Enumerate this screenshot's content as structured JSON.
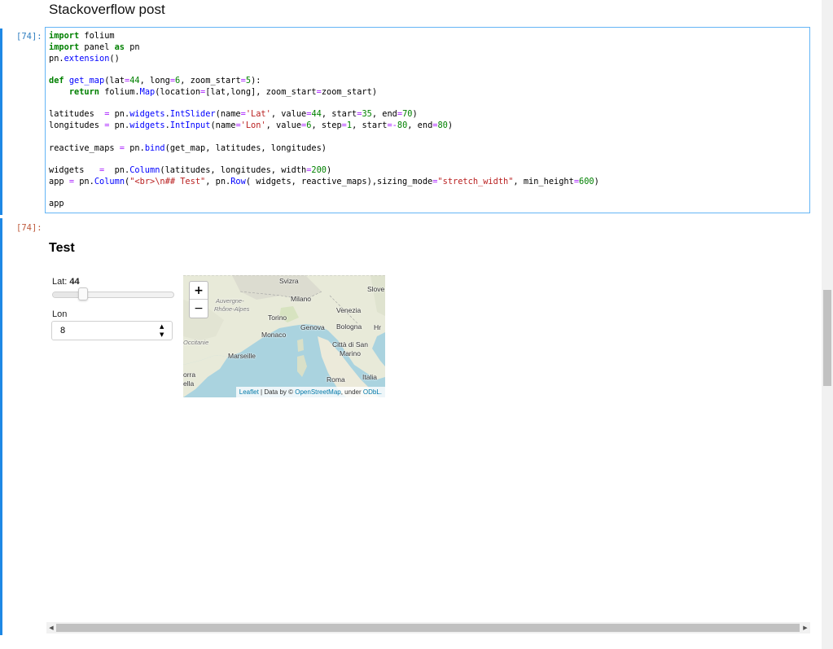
{
  "heading": "Stackoverflow post",
  "cell": {
    "in_prompt": "[74]:",
    "out_prompt": "[74]:",
    "code_lines": [
      [
        {
          "t": "import",
          "c": "kw"
        },
        {
          "t": " folium",
          "c": ""
        }
      ],
      [
        {
          "t": "import",
          "c": "kw"
        },
        {
          "t": " panel ",
          "c": ""
        },
        {
          "t": "as",
          "c": "kw"
        },
        {
          "t": " pn",
          "c": ""
        }
      ],
      [
        {
          "t": "pn",
          "c": ""
        },
        {
          "t": ".",
          "c": ""
        },
        {
          "t": "extension",
          "c": "fn"
        },
        {
          "t": "()",
          "c": ""
        }
      ],
      [],
      [
        {
          "t": "def",
          "c": "kw"
        },
        {
          "t": " ",
          "c": ""
        },
        {
          "t": "get_map",
          "c": "fn"
        },
        {
          "t": "(lat",
          "c": ""
        },
        {
          "t": "=",
          "c": "op"
        },
        {
          "t": "44",
          "c": "nu"
        },
        {
          "t": ", long",
          "c": ""
        },
        {
          "t": "=",
          "c": "op"
        },
        {
          "t": "6",
          "c": "nu"
        },
        {
          "t": ", zoom_start",
          "c": ""
        },
        {
          "t": "=",
          "c": "op"
        },
        {
          "t": "5",
          "c": "nu"
        },
        {
          "t": "):",
          "c": ""
        }
      ],
      [
        {
          "t": "    ",
          "c": ""
        },
        {
          "t": "return",
          "c": "kw"
        },
        {
          "t": " folium.",
          "c": ""
        },
        {
          "t": "Map",
          "c": "fn"
        },
        {
          "t": "(location",
          "c": ""
        },
        {
          "t": "=",
          "c": "op"
        },
        {
          "t": "[lat,long], zoom_start",
          "c": ""
        },
        {
          "t": "=",
          "c": "op"
        },
        {
          "t": "zoom_start)",
          "c": ""
        }
      ],
      [],
      [
        {
          "t": "latitudes  ",
          "c": ""
        },
        {
          "t": "=",
          "c": "op"
        },
        {
          "t": " pn.",
          "c": ""
        },
        {
          "t": "widgets",
          "c": "fn"
        },
        {
          "t": ".",
          "c": ""
        },
        {
          "t": "IntSlider",
          "c": "fn"
        },
        {
          "t": "(name",
          "c": ""
        },
        {
          "t": "=",
          "c": "op"
        },
        {
          "t": "'Lat'",
          "c": "st"
        },
        {
          "t": ", value",
          "c": ""
        },
        {
          "t": "=",
          "c": "op"
        },
        {
          "t": "44",
          "c": "nu"
        },
        {
          "t": ", start",
          "c": ""
        },
        {
          "t": "=",
          "c": "op"
        },
        {
          "t": "35",
          "c": "nu"
        },
        {
          "t": ", end",
          "c": ""
        },
        {
          "t": "=",
          "c": "op"
        },
        {
          "t": "70",
          "c": "nu"
        },
        {
          "t": ")",
          "c": ""
        }
      ],
      [
        {
          "t": "longitudes ",
          "c": ""
        },
        {
          "t": "=",
          "c": "op"
        },
        {
          "t": " pn.",
          "c": ""
        },
        {
          "t": "widgets",
          "c": "fn"
        },
        {
          "t": ".",
          "c": ""
        },
        {
          "t": "IntInput",
          "c": "fn"
        },
        {
          "t": "(name",
          "c": ""
        },
        {
          "t": "=",
          "c": "op"
        },
        {
          "t": "'Lon'",
          "c": "st"
        },
        {
          "t": ", value",
          "c": ""
        },
        {
          "t": "=",
          "c": "op"
        },
        {
          "t": "6",
          "c": "nu"
        },
        {
          "t": ", step",
          "c": ""
        },
        {
          "t": "=",
          "c": "op"
        },
        {
          "t": "1",
          "c": "nu"
        },
        {
          "t": ", start",
          "c": ""
        },
        {
          "t": "=-",
          "c": "op"
        },
        {
          "t": "80",
          "c": "nu"
        },
        {
          "t": ", end",
          "c": ""
        },
        {
          "t": "=",
          "c": "op"
        },
        {
          "t": "80",
          "c": "nu"
        },
        {
          "t": ")",
          "c": ""
        }
      ],
      [],
      [
        {
          "t": "reactive_maps ",
          "c": ""
        },
        {
          "t": "=",
          "c": "op"
        },
        {
          "t": " pn.",
          "c": ""
        },
        {
          "t": "bind",
          "c": "fn"
        },
        {
          "t": "(get_map, latitudes, longitudes)",
          "c": ""
        }
      ],
      [],
      [
        {
          "t": "widgets   ",
          "c": ""
        },
        {
          "t": "=",
          "c": "op"
        },
        {
          "t": "  pn.",
          "c": ""
        },
        {
          "t": "Column",
          "c": "fn"
        },
        {
          "t": "(latitudes, longitudes, width",
          "c": ""
        },
        {
          "t": "=",
          "c": "op"
        },
        {
          "t": "200",
          "c": "nu"
        },
        {
          "t": ")",
          "c": ""
        }
      ],
      [
        {
          "t": "app ",
          "c": ""
        },
        {
          "t": "=",
          "c": "op"
        },
        {
          "t": " pn.",
          "c": ""
        },
        {
          "t": "Column",
          "c": "fn"
        },
        {
          "t": "(",
          "c": ""
        },
        {
          "t": "\"<br>\\n## Test\"",
          "c": "st"
        },
        {
          "t": ", pn.",
          "c": ""
        },
        {
          "t": "Row",
          "c": "fn"
        },
        {
          "t": "( widgets, reactive_maps),sizing_mode",
          "c": ""
        },
        {
          "t": "=",
          "c": "op"
        },
        {
          "t": "\"stretch_width\"",
          "c": "st"
        },
        {
          "t": ", min_height",
          "c": ""
        },
        {
          "t": "=",
          "c": "op"
        },
        {
          "t": "600",
          "c": "nu"
        },
        {
          "t": ")",
          "c": ""
        }
      ],
      [],
      [
        {
          "t": "app",
          "c": ""
        }
      ]
    ]
  },
  "output": {
    "title": "Test",
    "lat_label": "Lat: ",
    "lat_value": "44",
    "slider": {
      "start": 35,
      "end": 70,
      "value": 44
    },
    "lon_label": "Lon",
    "lon_value": "8",
    "spin_up": "▲",
    "spin_down": "▼"
  },
  "map": {
    "zoom_in": "+",
    "zoom_out": "−",
    "labels": [
      {
        "text": "Svizra",
        "cls": ""
      },
      {
        "text": "Slove",
        "cls": ""
      },
      {
        "text": "Milano",
        "cls": ""
      },
      {
        "text": "Auvergne-",
        "cls": "region"
      },
      {
        "text": "Rhône-Alpes",
        "cls": "region"
      },
      {
        "text": "Venezia",
        "cls": ""
      },
      {
        "text": "Torino",
        "cls": ""
      },
      {
        "text": "Genova",
        "cls": ""
      },
      {
        "text": "Bologna",
        "cls": ""
      },
      {
        "text": "Hr",
        "cls": ""
      },
      {
        "text": "Monaco",
        "cls": ""
      },
      {
        "text": "Occitanie",
        "cls": "region"
      },
      {
        "text": "Città di San",
        "cls": ""
      },
      {
        "text": "Marino",
        "cls": ""
      },
      {
        "text": "Marseille",
        "cls": ""
      },
      {
        "text": "orra",
        "cls": ""
      },
      {
        "text": "ella",
        "cls": ""
      },
      {
        "text": "Roma",
        "cls": ""
      },
      {
        "text": "Italia",
        "cls": ""
      }
    ],
    "attribution": {
      "leaflet": "Leaflet",
      "sep": " | Data by © ",
      "osm": "OpenStreetMap",
      "under": ", under ",
      "odbl": "ODbL."
    }
  },
  "colors": {
    "accent": "#1e88e5",
    "water": "#aad3df",
    "land": "#f2efe9"
  },
  "scroll": {
    "left_arrow": "◀",
    "right_arrow": "▶"
  }
}
